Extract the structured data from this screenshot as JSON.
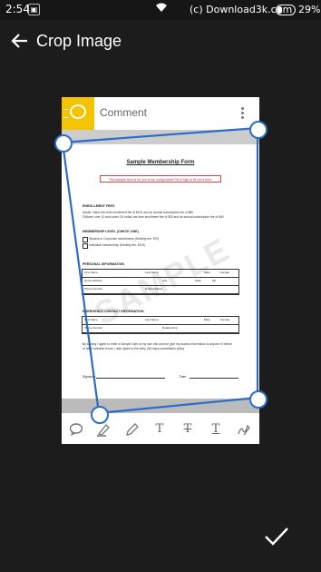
{
  "status_bar": {
    "time": "2:54",
    "notification_icon": "notification-icon",
    "wifi_icon": "wifi-icon",
    "brand": "(c) Download3k.com",
    "battery_percent": "29%",
    "battery_level": 0.29
  },
  "app_bar": {
    "back_icon": "back-arrow-icon",
    "title": "Crop Image"
  },
  "document": {
    "toolbar_label": "Comment",
    "form_title": "Sample Membership Form",
    "notice": "This sample form is for you to try, using Adobe Fill & Sign to fill out a form.",
    "sections": {
      "fees_title": "ENROLLMENT FEES",
      "fees_line1": "Adults: Initial one-time enrollment fee of $100 and an annual subscription fee of $80",
      "fees_line2": "Children over 10 and under 18: Initial one-time enrollment fee of $50 and an annual subscription fee of $40",
      "level_title": "MEMBERSHIP LEVEL (CHECK ONE)",
      "level_opt1": "Student or Corporate membership (Monthly fee: $70)",
      "level_opt2": "Individual membership (Monthly fee: $100)",
      "personal_title": "PERSONAL INFORMATION",
      "emergency_title": "EMERGENCY CONTACT INFORMATION",
      "agreement": "By signing I agree to enter a Sample Gym at my own risk and not give my access information to anyone in before",
      "agreement2": "or after invitation hours. I also agree to the thirty (30) days cancellation policy.",
      "signature_label": "Signature",
      "date_label": "Date"
    },
    "grid_labels": {
      "first_name": "First Name",
      "last_name": "Last Name",
      "male": "Male",
      "female": "Female",
      "home_address": "Home Address",
      "city": "City",
      "state": "State",
      "zip": "Zip",
      "phone": "Phone Number",
      "email": "Email Address",
      "relationship": "Relationship"
    },
    "watermark": "SAMPLE"
  },
  "doc_tools": [
    "comment-tool-icon",
    "highlight-tool-icon",
    "pencil-tool-icon",
    "text-tool-icon",
    "strikethrough-tool-icon",
    "underline-tool-icon",
    "signature-tool-icon"
  ],
  "confirm_icon": "checkmark-icon",
  "crop_color": "#2a6cc7"
}
